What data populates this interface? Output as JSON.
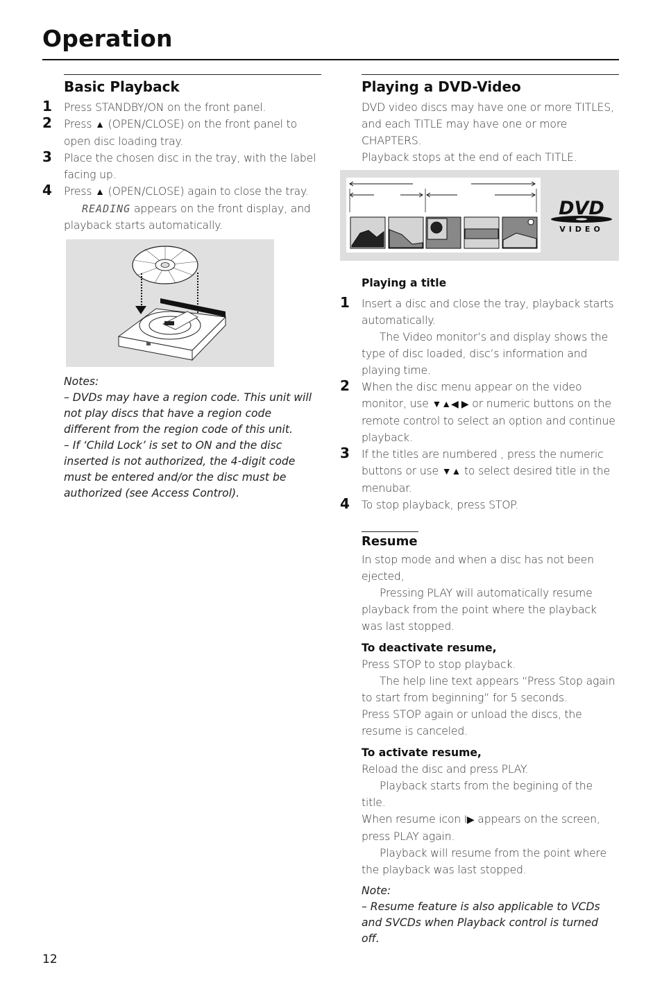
{
  "page": {
    "title": "Operation",
    "page_number": "12"
  },
  "basic_playback": {
    "heading": "Basic Playback",
    "steps": [
      {
        "num": "1",
        "text": "Press STANDBY/ON on the front panel."
      },
      {
        "num": "2",
        "pre": "Press ",
        "icon": "▲",
        "post": " (OPEN/CLOSE) on the front panel to open disc loading tray."
      },
      {
        "num": "3",
        "text": "Place the chosen disc in the tray, with the label facing up."
      },
      {
        "num": "4",
        "pre": "Press ",
        "icon": "▲",
        "post": " (OPEN/CLOSE) again to close the tray.",
        "display_text": "READING",
        "sub": " appears on the front display, and playback starts automatically."
      }
    ],
    "figure_caption": "disc-tray-illustration",
    "notes_label": "Notes:",
    "notes": [
      "–   DVDs may have a region code. This unit will not play discs that have a region code different from the region code of  this unit.",
      "–   If ‘Child Lock’ is set to ON and the disc inserted is not authorized, the 4-digit code must be entered and/or the disc must be authorized (see Access Control)."
    ]
  },
  "dvd_video": {
    "heading": "Playing a DVD-Video",
    "intro": [
      "DVD video discs may have one or more TITLES, and each TITLE may have one or more CHAPTERS.",
      "Playback stops at the end of each TITLE."
    ],
    "logo": {
      "main": "DVD",
      "sub": "VIDEO"
    },
    "playing_title": {
      "heading": "Playing a title",
      "steps": [
        {
          "num": "1",
          "text": "Insert a disc and close the tray, playback starts automatically.",
          "sub": "The Video monitor’s and display shows the type of disc loaded, disc’s information and playing time."
        },
        {
          "num": "2",
          "pre": "When the disc menu appear on the video monitor, use ",
          "icon": "▼▲◀ ▶",
          "post": " or numeric buttons on the remote control to select an option and continue playback."
        },
        {
          "num": "3",
          "pre": "If the titles are numbered , press the numeric buttons or use ",
          "icon": "▼▲",
          "post": " to select desired title in the menubar."
        },
        {
          "num": "4",
          "text": "To stop playback, press STOP."
        }
      ]
    }
  },
  "resume": {
    "heading": "Resume",
    "intro": "In stop mode and when a disc has not been ejected,",
    "intro_sub": "Pressing PLAY will automatically resume playback from the point where the playback was last stopped.",
    "deactivate": {
      "heading": "To deactivate resume,",
      "line1": "Press STOP to stop playback.",
      "line2": "The help line text appears “Press Stop again to start from beginning” for 5 seconds.",
      "line3": "Press STOP again or unload the discs, the resume is canceled."
    },
    "activate": {
      "heading": "To activate resume,",
      "line1": "Reload the disc and press PLAY.",
      "line2": "Playback starts from the begining of the title.",
      "line3_pre": "When resume icon ",
      "line3_icon": "I▶",
      "line3_post": " appears on the screen, press PLAY again.",
      "line4": "Playback will resume from the point where the playback was last stopped."
    },
    "note_label": "Note:",
    "note": "–   Resume feature is also applicable to VCDs and SVCDs when Playback control is turned off."
  }
}
